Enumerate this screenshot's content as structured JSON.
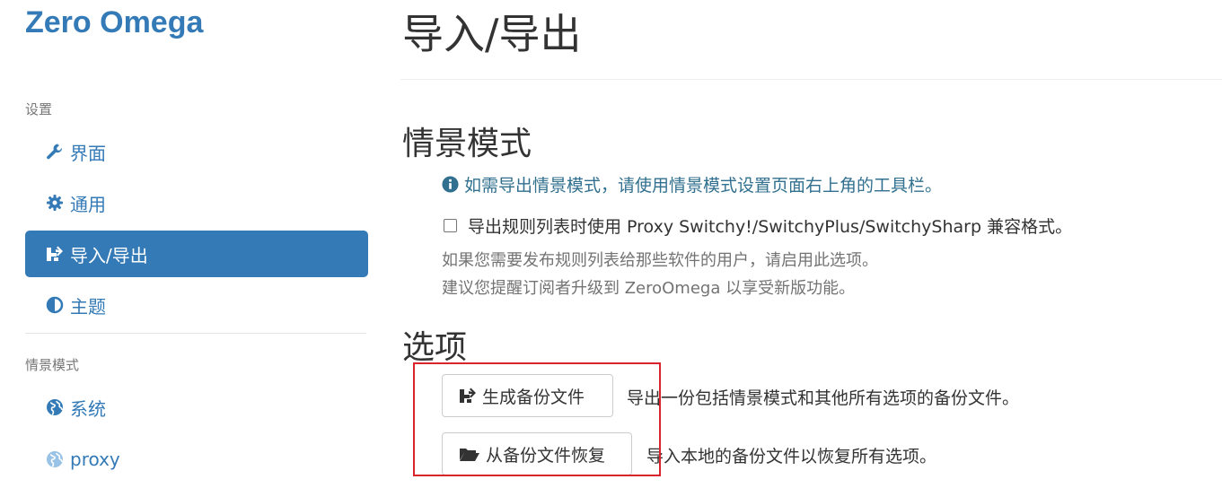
{
  "brand": "Zero Omega",
  "sidebar": {
    "settings_header": "设置",
    "items": [
      {
        "label": "界面",
        "icon": "wrench-icon"
      },
      {
        "label": "通用",
        "icon": "gear-icon"
      },
      {
        "label": "导入/导出",
        "icon": "import-export-icon",
        "active": true
      },
      {
        "label": "主题",
        "icon": "contrast-icon"
      }
    ],
    "profiles_header": "情景模式",
    "profiles": [
      {
        "label": "系统",
        "icon": "globe-icon"
      },
      {
        "label": "proxy",
        "icon": "globe-icon"
      }
    ]
  },
  "main": {
    "page_title": "导入/导出",
    "profiles_section": {
      "title": "情景模式",
      "info": "如需导出情景模式，请使用情景模式设置页面右上角的工具栏。",
      "checkbox_label": "导出规则列表时使用 Proxy Switchy!/SwitchyPlus/SwitchySharp 兼容格式。",
      "checkbox_checked": false,
      "help_line1": "如果您需要发布规则列表给那些软件的用户，请启用此选项。",
      "help_line2": "建议您提醒订阅者升级到 ZeroOmega 以享受新版功能。"
    },
    "options_section": {
      "title": "选项",
      "backup_button": "生成备份文件",
      "backup_desc": "导出一份包括情景模式和其他所有选项的备份文件。",
      "restore_button": "从备份文件恢复",
      "restore_desc": "导入本地的备份文件以恢复所有选项。"
    }
  },
  "colors": {
    "accent": "#337ab7",
    "info": "#31708f",
    "highlight": "#d9232d"
  }
}
